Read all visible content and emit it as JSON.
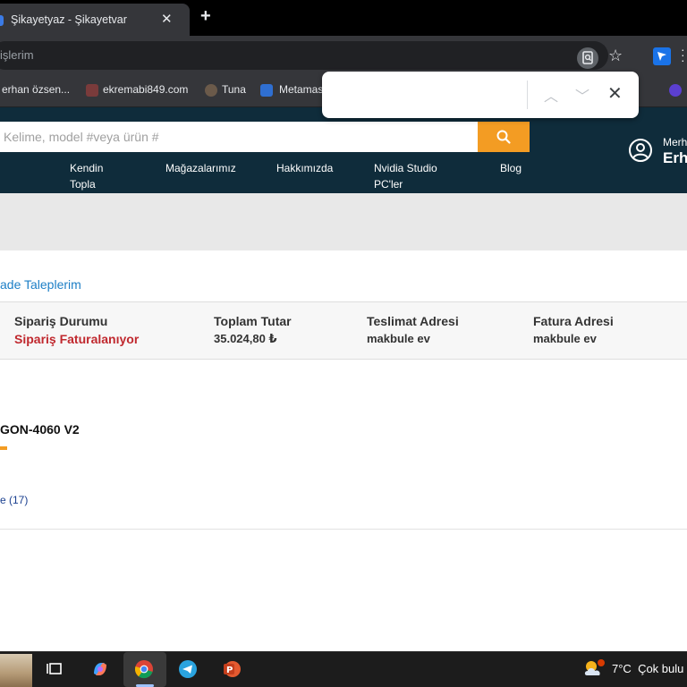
{
  "browser": {
    "tab_title": "Şikayetyaz - Şikayetvar",
    "address_text": "işlerim",
    "bookmarks": [
      "erhan özsen...",
      "ekremabi849.com",
      "Tuna",
      "Metamas"
    ]
  },
  "find_bar": {
    "query": ""
  },
  "site": {
    "search_placeholder": "Kelime, model #veya ürün #",
    "greeting_line1": "Merh",
    "greeting_line2": "Erha",
    "nav": [
      {
        "line1": "Kendin",
        "line2": "Topla"
      },
      {
        "line1": "Mağazalarımız",
        "line2": ""
      },
      {
        "line1": "Hakkımızda",
        "line2": ""
      },
      {
        "line1": "Nvidia Studio",
        "line2": "PC'ler"
      },
      {
        "line1": "Blog",
        "line2": ""
      }
    ]
  },
  "order": {
    "breadcrumb_link": "ade Taleplerim",
    "status_label": "Sipariş Durumu",
    "status_value": "Sipariş Faturalanıyor",
    "total_label": "Toplam Tutar",
    "total_value": "35.024,80 ₺",
    "delivery_label": "Teslimat Adresi",
    "delivery_value": "makbule ev",
    "invoice_label": "Fatura Adresi",
    "invoice_value": "makbule ev",
    "status_color": "#c0282e"
  },
  "product": {
    "name": "GON-4060 V2",
    "reviews": "e (17)"
  },
  "taskbar": {
    "weather_temp": "7°C",
    "weather_desc": "Çok bulu"
  },
  "colors": {
    "header_bg": "#0f2c3b",
    "search_button": "#f39c23",
    "link": "#1d7fc6"
  }
}
